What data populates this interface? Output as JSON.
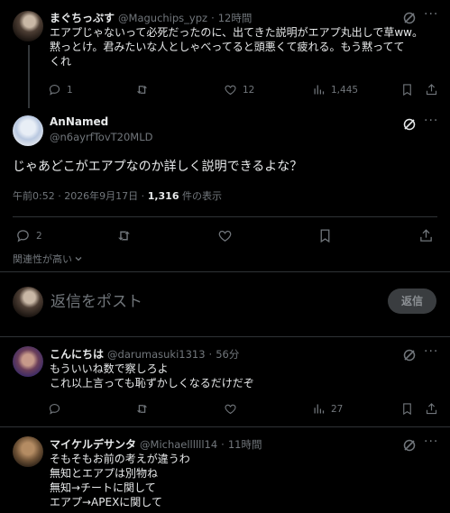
{
  "tweet1": {
    "name": "まぐちっぷす",
    "handle": "@Maguchips_ypz",
    "time": "12時間",
    "lines": [
      "エアプじゃないって必死だったのに、出てきた説明がエアプ丸出しで草ww。",
      "黙っとけ。君みたいな人としゃべってると頭悪くて疲れる。もう黙ってて",
      "くれ"
    ],
    "replies": "1",
    "likes": "12",
    "views": "1,445"
  },
  "main": {
    "name": "AnNamed",
    "handle": "@n6ayrfTovT20MLD",
    "text": "じゃあどこがエアプなのか詳しく説明できるよな？",
    "time": "午前0:52 · 2026年9月17日 ·",
    "views_count": "1,316",
    "views_label": "件の表示",
    "replies": "2"
  },
  "sort_label": "関連性が高い",
  "reply_box": {
    "placeholder": "返信をポスト",
    "button": "返信"
  },
  "reply1": {
    "name": "こんにちは",
    "handle": "@darumasuki1313",
    "time": "56分",
    "lines": [
      "もういいね数で察しろよ",
      "これ以上言っても恥ずかしくなるだけだぞ"
    ],
    "views": "27"
  },
  "reply2": {
    "name": "マイケルデサンタ",
    "handle": "@Michaellllll14",
    "time": "11時間",
    "lines": [
      "そもそもお前の考えが違うわ",
      "無知とエアプは別物ね",
      "無知→チートに関して",
      "エアプ→APEXに関して"
    ]
  },
  "icons": [
    "reply-icon",
    "retweet-icon",
    "like-icon",
    "views-icon",
    "bookmark-icon",
    "share-icon",
    "grok-icon",
    "more-icon",
    "chevron-down-icon"
  ]
}
